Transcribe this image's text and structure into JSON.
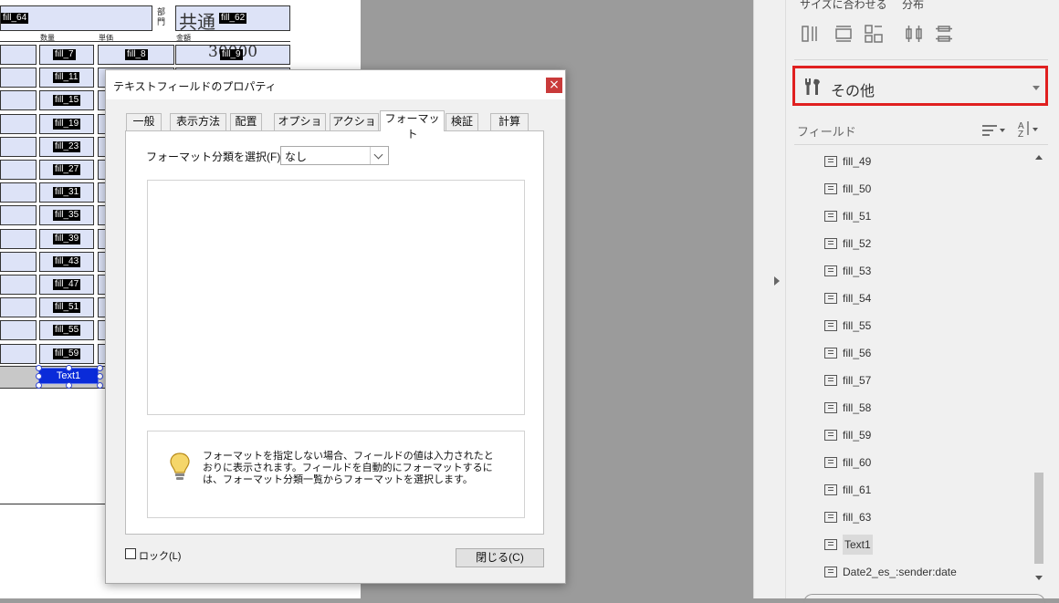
{
  "document": {
    "top_left_field": "fill_64",
    "dept_label": "部門",
    "kyotsu": "共通",
    "top_right_field": "fill_62",
    "col_headers": [
      "数量",
      "単価",
      "金額"
    ],
    "row_fields": [
      "fill_7",
      "fill_11",
      "fill_15",
      "fill_19",
      "fill_23",
      "fill_27",
      "fill_31",
      "fill_35",
      "fill_39",
      "fill_43",
      "fill_47",
      "fill_51",
      "fill_55",
      "fill_59"
    ],
    "row1_col2_field": "fill_8",
    "row1_col3_value": "30000",
    "row1_col3_field": "fill_9",
    "selected_field": "Text1"
  },
  "dialog": {
    "title": "テキストフィールドのプロパティ",
    "close_glyph": "×",
    "tabs": [
      "一般",
      "表示方法",
      "配置",
      "オプション",
      "アクション",
      "フォーマット",
      "検証",
      "計算"
    ],
    "active_tab": "フォーマット",
    "format_label": "フォーマット分類を選択(F) :",
    "format_value": "なし",
    "info_text": [
      "フォーマットを指定しない場合、フィールドの値は入力されたと",
      "おりに表示されます。フィールドを自動的にフォーマットするに",
      "は、フォーマット分類一覧からフォーマットを選択します。"
    ],
    "lock_label": "ロック(L)",
    "close_button": "閉じる(C)"
  },
  "panel": {
    "fit_size_label": "サイズに合わせる",
    "distribute_label": "分布",
    "other_label": "その他",
    "fields_label": "フィールド",
    "field_items": [
      "fill_49",
      "fill_50",
      "fill_51",
      "fill_52",
      "fill_53",
      "fill_54",
      "fill_55",
      "fill_56",
      "fill_57",
      "fill_58",
      "fill_59",
      "fill_60",
      "fill_61",
      "fill_63",
      "Text1",
      "Date2_es_:sender:date"
    ],
    "selected_item": "Text1",
    "highlight_color": "#e02020"
  }
}
